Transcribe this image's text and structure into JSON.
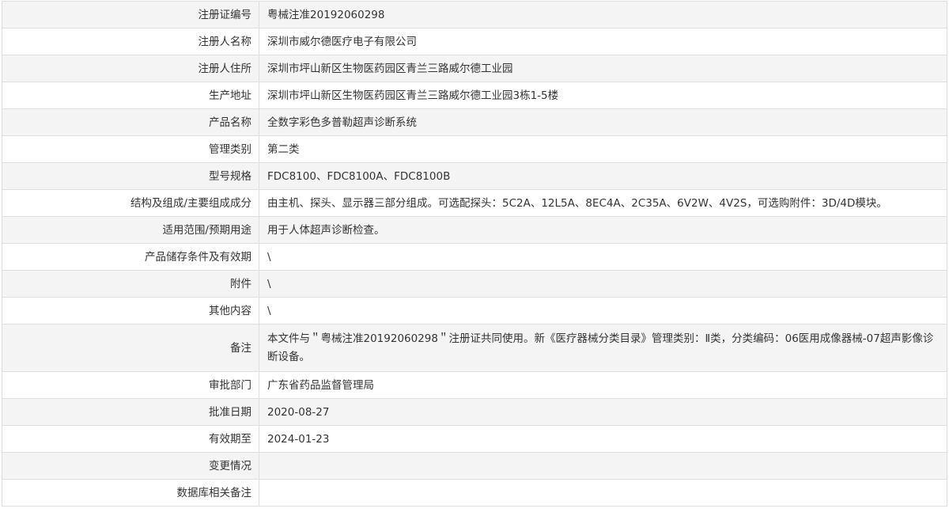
{
  "rows": [
    {
      "label": "注册证编号",
      "value": "粤械注准20192060298"
    },
    {
      "label": "注册人名称",
      "value": "深圳市威尔德医疗电子有限公司"
    },
    {
      "label": "注册人住所",
      "value": "深圳市坪山新区生物医药园区青兰三路威尔德工业园"
    },
    {
      "label": "生产地址",
      "value": "深圳市坪山新区生物医药园区青兰三路威尔德工业园3栋1-5楼"
    },
    {
      "label": "产品名称",
      "value": "全数字彩色多普勒超声诊断系统"
    },
    {
      "label": "管理类别",
      "value": "第二类"
    },
    {
      "label": "型号规格",
      "value": "FDC8100、FDC8100A、FDC8100B"
    },
    {
      "label": "结构及组成/主要组成成分",
      "value": "由主机、探头、显示器三部分组成。可选配探头：5C2A、12L5A、8EC4A、2C35A、6V2W、4V2S，可选购附件：3D/4D模块。"
    },
    {
      "label": "适用范围/预期用途",
      "value": "用于人体超声诊断检查。"
    },
    {
      "label": "产品储存条件及有效期",
      "value": "\\"
    },
    {
      "label": "附件",
      "value": "\\"
    },
    {
      "label": "其他内容",
      "value": "\\"
    },
    {
      "label": "备注",
      "value": "本文件与＂粤械注准20192060298＂注册证共同使用。新《医疗器械分类目录》管理类别：Ⅱ类，分类编码：06医用成像器械-07超声影像诊断设备。"
    },
    {
      "label": "审批部门",
      "value": "广东省药品监督管理局"
    },
    {
      "label": "批准日期",
      "value": "2020-08-27"
    },
    {
      "label": "有效期至",
      "value": "2024-01-23"
    },
    {
      "label": "变更情况",
      "value": ""
    },
    {
      "label": "数据库相关备注",
      "value": ""
    }
  ]
}
